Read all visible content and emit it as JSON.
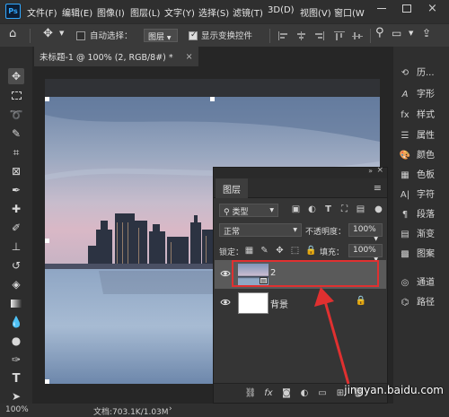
{
  "app": {
    "logo": "Ps"
  },
  "menu": [
    "文件(F)",
    "编辑(E)",
    "图像(I)",
    "图层(L)",
    "文字(Y)",
    "选择(S)",
    "滤镜(T)",
    "3D(D)",
    "视图(V)",
    "窗口(W"
  ],
  "options": {
    "auto_select_label": "自动选择：",
    "auto_select_value": "图层",
    "show_transform_label": "显示变换控件",
    "show_transform_checked": true
  },
  "document": {
    "tab_title": "未标题-1 @ 100% (2, RGB/8#) *",
    "tab_close": "×"
  },
  "right_panel": {
    "items": [
      {
        "label": "历...",
        "icon": "history-icon"
      },
      {
        "label": "字形",
        "icon": "glyphs-icon"
      },
      {
        "label": "样式",
        "icon": "styles-icon"
      },
      {
        "label": "属性",
        "icon": "properties-icon"
      },
      {
        "label": "颜色",
        "icon": "color-icon"
      },
      {
        "label": "色板",
        "icon": "swatches-icon"
      },
      {
        "label": "字符",
        "icon": "character-icon"
      },
      {
        "label": "段落",
        "icon": "paragraph-icon"
      },
      {
        "label": "渐变",
        "icon": "gradient-icon"
      },
      {
        "label": "图案",
        "icon": "pattern-icon"
      },
      {
        "label": "通道",
        "icon": "channels-icon"
      },
      {
        "label": "路径",
        "icon": "paths-icon"
      }
    ]
  },
  "layers_panel": {
    "title": "图层",
    "filter_kind": "类型",
    "blend_mode": "正常",
    "opacity_label": "不透明度：",
    "opacity_value": "100%",
    "lock_label": "锁定：",
    "fill_label": "填充：",
    "fill_value": "100%",
    "layers": [
      {
        "name": "2",
        "selected": true,
        "thumb": "photo"
      },
      {
        "name": "背景",
        "selected": false,
        "thumb": "white",
        "locked": true
      }
    ]
  },
  "status": {
    "doc_info": "文档:703.1K/1.03M"
  },
  "watermark": "jingyan.baidu.com",
  "colors": {
    "highlight_box": "#e03030",
    "arrow": "#e03030",
    "accent": "#31a8ff"
  }
}
